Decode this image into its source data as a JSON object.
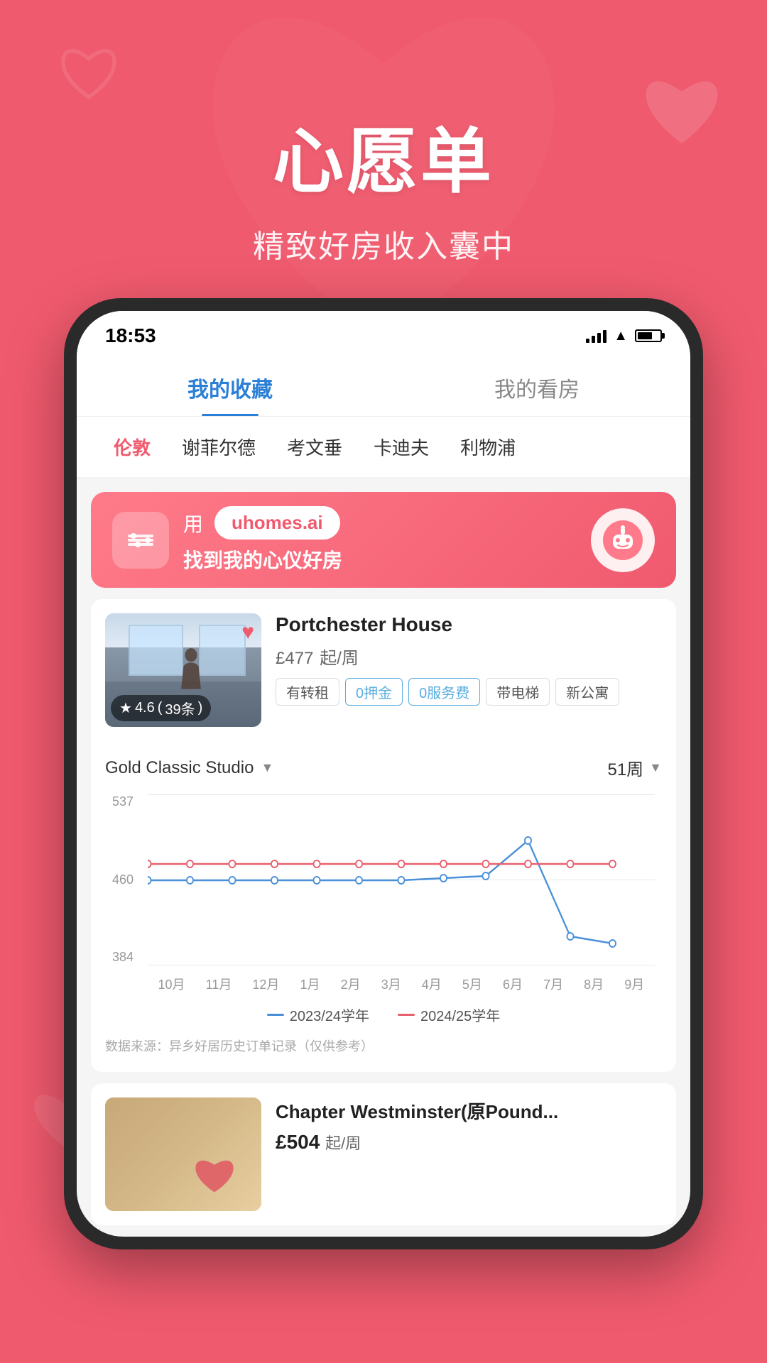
{
  "app": {
    "background_color": "#f05a6e"
  },
  "hero": {
    "title": "心愿单",
    "subtitle": "精致好房收入囊中"
  },
  "status_bar": {
    "time": "18:53",
    "signal": "signal",
    "wifi": "wifi",
    "battery": "battery"
  },
  "tabs": [
    {
      "label": "我的收藏",
      "active": true
    },
    {
      "label": "我的看房",
      "active": false
    }
  ],
  "city_filters": [
    {
      "label": "伦敦",
      "active": true
    },
    {
      "label": "谢菲尔德",
      "active": false
    },
    {
      "label": "考文垂",
      "active": false
    },
    {
      "label": "卡迪夫",
      "active": false
    },
    {
      "label": "利物浦",
      "active": false
    }
  ],
  "banner": {
    "use_text": "用",
    "url_text": "uhomes.ai",
    "slogan": "找到我的心仪好房"
  },
  "properties": [
    {
      "name": "Portchester House",
      "price": "£477",
      "price_suffix": "起/周",
      "rating": "4.6",
      "rating_count": "39条",
      "tags": [
        "有转租",
        "0押金",
        "0服务费",
        "带电梯",
        "新公寓"
      ],
      "heart": "♥"
    },
    {
      "name": "Chapter Westminster(原Pound...",
      "price": "£504",
      "price_suffix": "起/周"
    }
  ],
  "chart": {
    "type_selector": "Gold Classic Studio",
    "week_selector": "51周",
    "y_labels": [
      "537",
      "460",
      "384"
    ],
    "x_labels": [
      "10月",
      "11月",
      "12月",
      "1月",
      "2月",
      "3月",
      "4月",
      "5月",
      "6月",
      "7月",
      "8月",
      "9月"
    ],
    "legend": [
      {
        "label": "2023/24学年",
        "color": "#4a90d9"
      },
      {
        "label": "2024/25学年",
        "color": "#e8606e"
      }
    ],
    "source": "数据来源：异乡好居历史订单记录（仅供参考）"
  }
}
